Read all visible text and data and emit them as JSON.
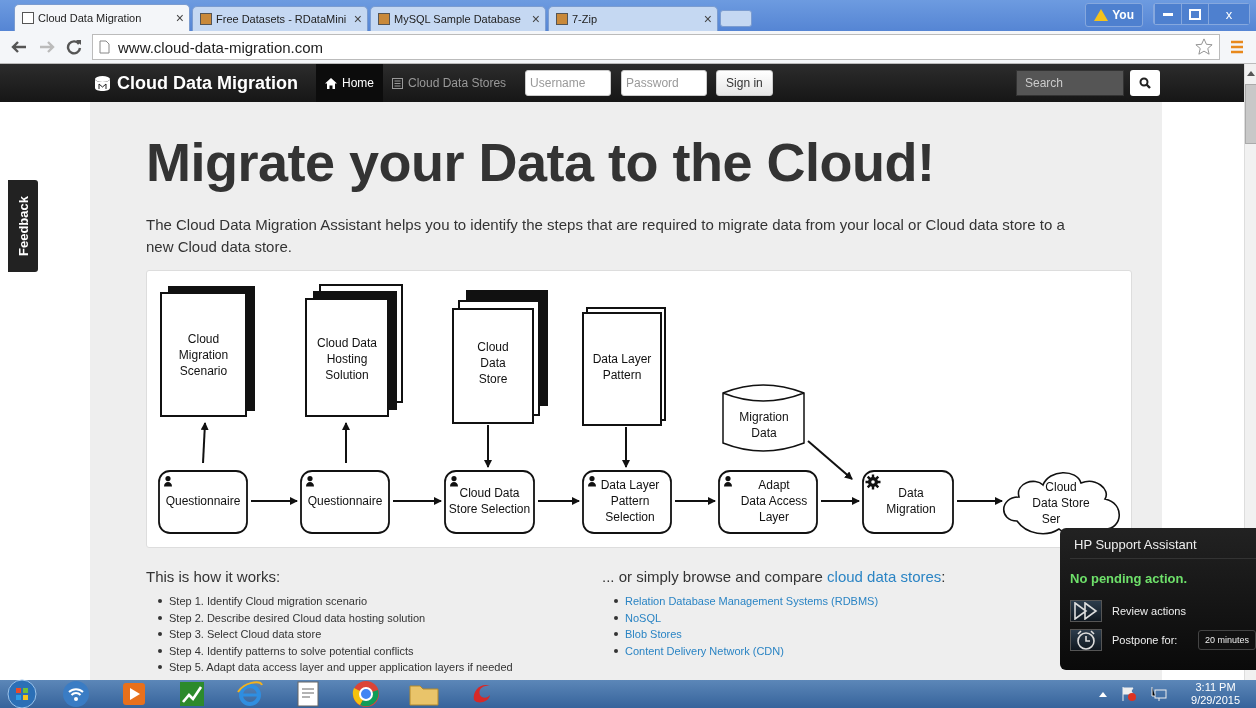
{
  "browser": {
    "tabs": [
      {
        "title": "Cloud Data Migration",
        "selected": true
      },
      {
        "title": "Free Datasets - RDataMini",
        "selected": false
      },
      {
        "title": "MySQL Sample Database",
        "selected": false
      },
      {
        "title": "7-Zip",
        "selected": false
      }
    ],
    "close_glyph": "×",
    "profile": "You",
    "window_close": "x",
    "url": "www.cloud-data-migration.com"
  },
  "navbar": {
    "brand": "Cloud Data Migration",
    "links": [
      {
        "label": "Home",
        "selected": true
      },
      {
        "label": "Cloud Data Stores",
        "selected": false
      }
    ],
    "username_placeholder": "Username",
    "password_placeholder": "Password",
    "sign_in": "Sign in",
    "search_placeholder": "Search"
  },
  "feedback": "Feedback",
  "heading": "Migrate your Data to the Cloud!",
  "intro": "The Cloud Data Migration Assistant helps you to identify the steps that are required to migrate data from your local or Cloud data store to a new Cloud data store.",
  "diagram": {
    "documents": [
      {
        "lines": [
          "Cloud",
          "Migration",
          "Scenario"
        ]
      },
      {
        "lines": [
          "Cloud Data",
          "Hosting",
          "Solution"
        ]
      },
      {
        "lines": [
          "Cloud",
          "Data",
          "Store"
        ]
      },
      {
        "lines": [
          "Data Layer",
          "Pattern"
        ]
      }
    ],
    "data_store": {
      "lines": [
        "Migration",
        "Data"
      ]
    },
    "steps": [
      {
        "kind": "user",
        "lines": [
          "Questionnaire"
        ]
      },
      {
        "kind": "user",
        "lines": [
          "Questionnaire"
        ]
      },
      {
        "kind": "user",
        "lines": [
          "Cloud Data",
          "Store Selection"
        ]
      },
      {
        "kind": "user",
        "lines": [
          "Data Layer",
          "Pattern",
          "Selection"
        ]
      },
      {
        "kind": "user",
        "lines": [
          "Adapt",
          "Data Access",
          "Layer"
        ]
      },
      {
        "kind": "automated",
        "lines": [
          "Data",
          "Migration"
        ]
      }
    ],
    "target": {
      "lines": [
        "Cloud",
        "Data Store",
        "Ser"
      ]
    }
  },
  "how": {
    "title": "This is how it works:",
    "steps": [
      "Step 1. Identify Cloud migration scenario",
      "Step 2. Describe desired Cloud data hosting solution",
      "Step 3. Select Cloud data store",
      "Step 4. Identify patterns to solve potential conflicts",
      "Step 5. Adapt data access layer and upper application layers if needed"
    ]
  },
  "browse": {
    "title_start": "... or simply browse and compare",
    "title_link": "cloud data stores",
    "title_end": ":",
    "links": [
      "Relation Database Management Systems (RDBMS)",
      "NoSQL",
      "Blob Stores",
      "Content Delivery Network (CDN)"
    ]
  },
  "hp_popup": {
    "title": "HP Support Assistant",
    "status": "No pending action.",
    "review": "Review actions",
    "postpone": "Postpone for:",
    "duration": "20 minutes"
  },
  "taskbar": {
    "time": "3:11 PM",
    "date": "9/29/2015"
  }
}
